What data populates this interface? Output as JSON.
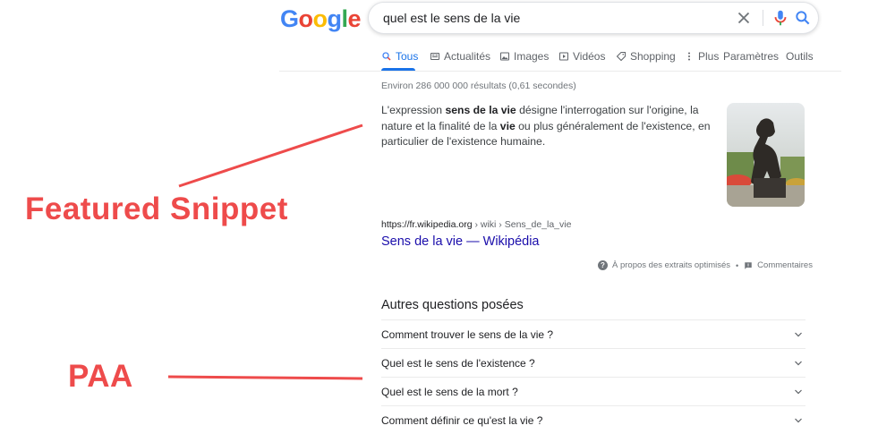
{
  "logo": {
    "letters": [
      "G",
      "o",
      "o",
      "g",
      "l",
      "e"
    ],
    "colors": [
      "#4285F4",
      "#EA4335",
      "#FBBC05",
      "#4285F4",
      "#34A853",
      "#EA4335"
    ]
  },
  "search": {
    "query": "quel est le sens de la vie"
  },
  "tabs": [
    {
      "label": "Tous",
      "icon": "search-icon",
      "active": true
    },
    {
      "label": "Actualités",
      "icon": "news-icon"
    },
    {
      "label": "Images",
      "icon": "image-icon"
    },
    {
      "label": "Vidéos",
      "icon": "video-icon"
    },
    {
      "label": "Shopping",
      "icon": "tag-icon"
    },
    {
      "label": "Plus",
      "icon": "more-vert-icon"
    },
    {
      "label": "Paramètres"
    },
    {
      "label": "Outils"
    }
  ],
  "stats": "Environ 286 000 000 résultats (0,61 secondes)",
  "snippet": {
    "parts": [
      {
        "text": "L'expression ",
        "bold": false
      },
      {
        "text": "sens de la vie",
        "bold": true
      },
      {
        "text": " désigne l'interrogation sur l'origine, la nature et la finalité de la ",
        "bold": false
      },
      {
        "text": "vie",
        "bold": true
      },
      {
        "text": " ou plus généralement de l'existence, en particulier de l'existence humaine.",
        "bold": false
      }
    ],
    "url_domain": "https://fr.wikipedia.org",
    "url_path": " › wiki › Sens_de_la_vie",
    "title": "Sens de la vie — Wikipédia"
  },
  "about": {
    "extracts": "À propos des extraits optimisés",
    "separator": "•",
    "comments": "Commentaires"
  },
  "paa": {
    "title": "Autres questions posées",
    "questions": [
      "Comment trouver le sens de la vie ?",
      "Quel est le sens de l'existence ?",
      "Quel est le sens de la mort ?",
      "Comment définir ce qu'est la vie ?"
    ]
  },
  "annotations": {
    "featured": "Featured Snippet",
    "paa": "PAA",
    "color": "#ee4b4b"
  }
}
